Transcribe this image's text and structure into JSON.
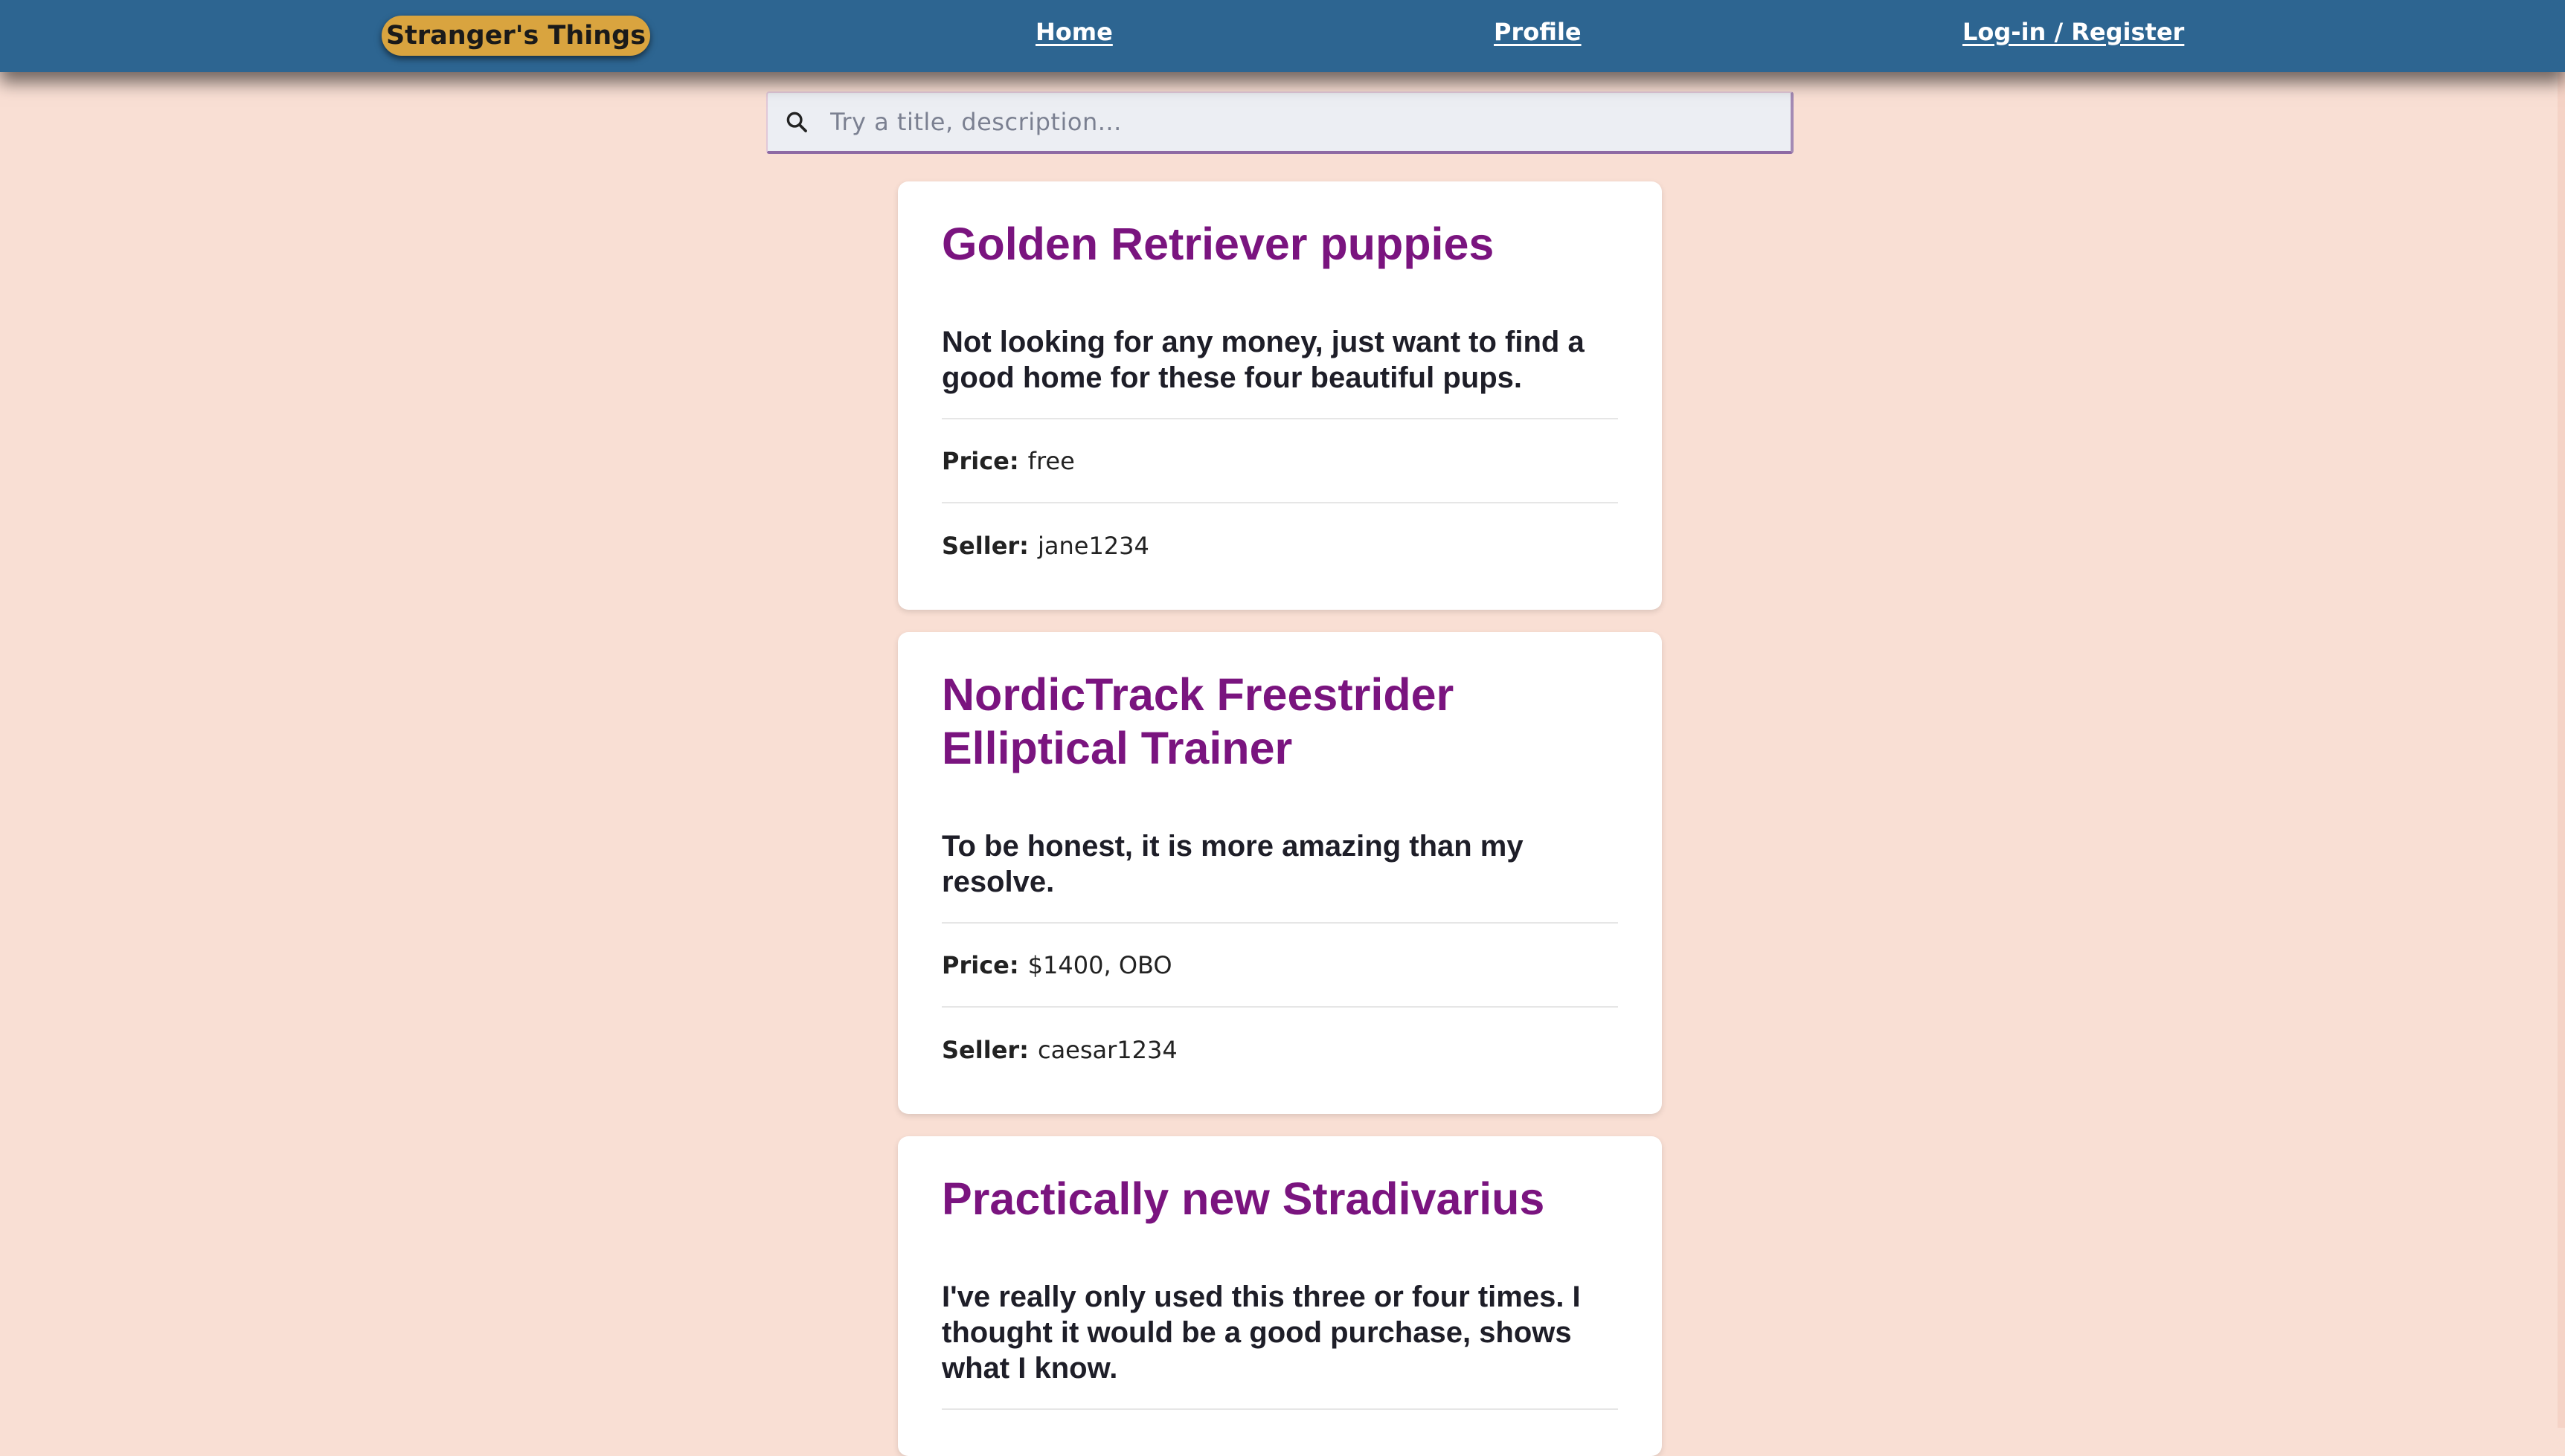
{
  "navbar": {
    "brand": "Stranger's Things",
    "links": {
      "home": "Home",
      "profile": "Profile",
      "login": "Log-in / Register"
    }
  },
  "search": {
    "placeholder": "Try a title, description...",
    "value": "",
    "icon": "search-icon"
  },
  "labels": {
    "price": "Price:",
    "seller": "Seller:"
  },
  "posts": [
    {
      "title": "Golden Retriever puppies",
      "description": "Not looking for any money, just want to find a good home for these four beautiful pups.",
      "price": "free",
      "seller": "jane1234"
    },
    {
      "title": "NordicTrack Freestrider Elliptical Trainer",
      "description": "To be honest, it is more amazing than my resolve.",
      "price": "$1400, OBO",
      "seller": "caesar1234"
    },
    {
      "title": "Practically new Stradivarius",
      "description": "I've really only used this three or four times. I thought it would be a good purchase, shows what I know."
    }
  ],
  "colors": {
    "navbar_bg": "#2d6591",
    "brand_bg": "#d9a43f",
    "page_bg": "#f9dfd4",
    "title_color": "#7a147f"
  }
}
